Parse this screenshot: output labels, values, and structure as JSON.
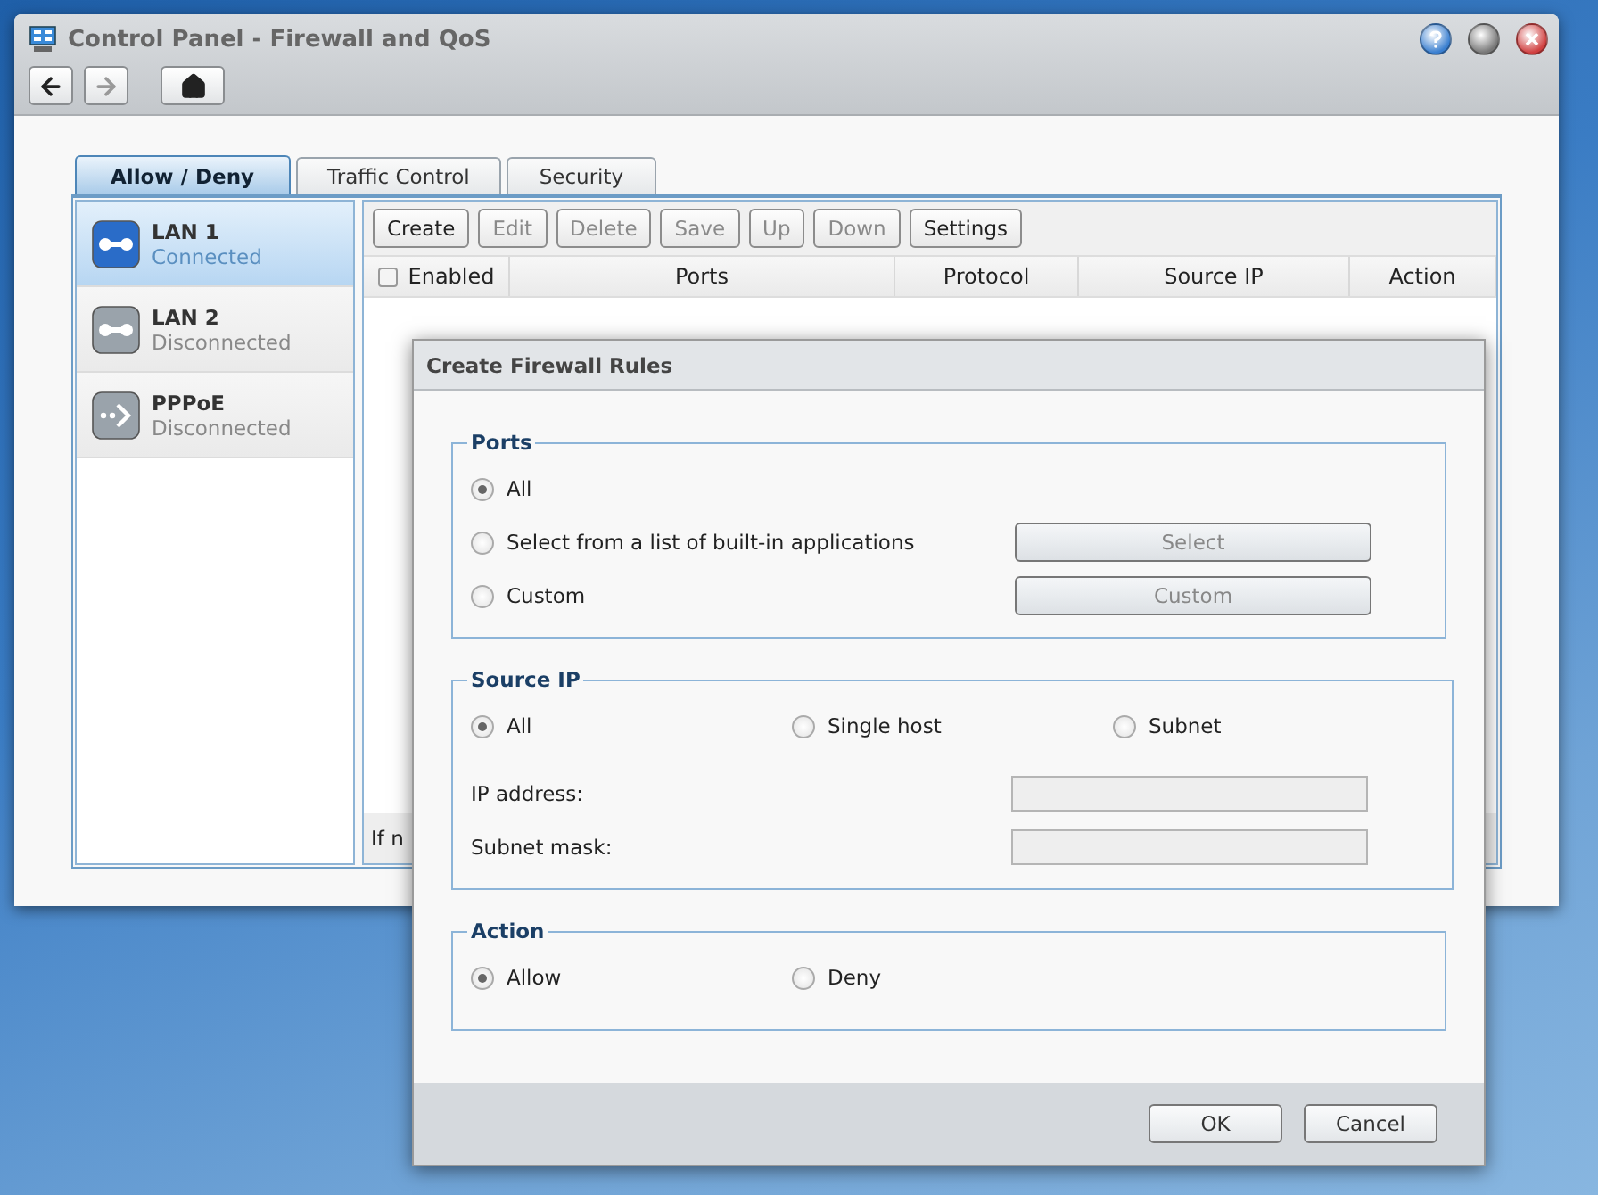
{
  "window": {
    "title": "Control Panel - Firewall and QoS"
  },
  "nav": [
    {
      "kind": "back",
      "disabled": false
    },
    {
      "kind": "forward",
      "disabled": true
    },
    {
      "kind": "home",
      "disabled": false
    }
  ],
  "window_controls": [
    {
      "kind": "help"
    },
    {
      "kind": "minimize"
    },
    {
      "kind": "close"
    }
  ],
  "tabs": [
    {
      "label": "Allow / Deny",
      "selected": true
    },
    {
      "label": "Traffic Control",
      "selected": false
    },
    {
      "label": "Security",
      "selected": false
    }
  ],
  "interfaces": [
    {
      "kind": "lan",
      "name": "LAN 1",
      "status": "Connected",
      "selected": true
    },
    {
      "kind": "lan",
      "name": "LAN 2",
      "status": "Disconnected",
      "selected": false
    },
    {
      "kind": "pppoe",
      "name": "PPPoE",
      "status": "Disconnected",
      "selected": false
    }
  ],
  "toolbar": [
    {
      "label": "Create",
      "disabled": false
    },
    {
      "label": "Edit",
      "disabled": true
    },
    {
      "label": "Delete",
      "disabled": true
    },
    {
      "label": "Save",
      "disabled": true
    },
    {
      "label": "Up",
      "disabled": true
    },
    {
      "label": "Down",
      "disabled": true
    },
    {
      "label": "Settings",
      "disabled": false
    }
  ],
  "table": {
    "select_all_checked": false,
    "columns": [
      "Enabled",
      "Ports",
      "Protocol",
      "Source IP",
      "Action"
    ]
  },
  "status_text": "If n",
  "dialog": {
    "title": "Create Firewall Rules",
    "ports": {
      "title": "Ports",
      "options": [
        {
          "label": "All",
          "selected": true
        },
        {
          "label": "Select from a list of built-in applications",
          "selected": false,
          "button": {
            "label": "Select",
            "disabled": true
          }
        },
        {
          "label": "Custom",
          "selected": false,
          "button": {
            "label": "Custom",
            "disabled": true
          }
        }
      ]
    },
    "source_ip": {
      "title": "Source IP",
      "options": [
        {
          "label": "All",
          "selected": true
        },
        {
          "label": "Single host",
          "selected": false
        },
        {
          "label": "Subnet",
          "selected": false
        }
      ],
      "fields": [
        {
          "label": "IP address:",
          "disabled": true
        },
        {
          "label": "Subnet mask:",
          "disabled": true
        }
      ]
    },
    "action": {
      "title": "Action",
      "options": [
        {
          "label": "Allow",
          "selected": true
        },
        {
          "label": "Deny",
          "selected": false
        }
      ]
    },
    "buttons": [
      "OK",
      "Cancel"
    ]
  }
}
